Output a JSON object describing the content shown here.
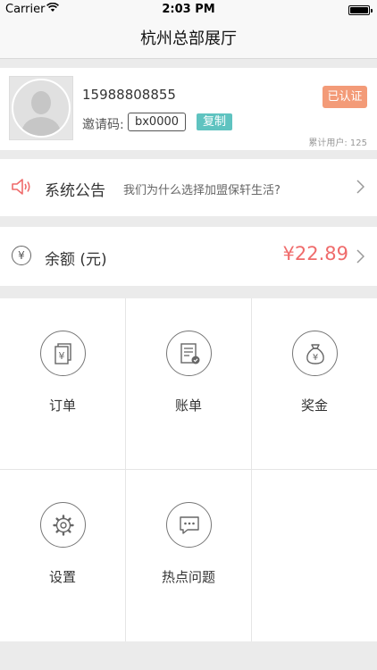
{
  "status_bar": {
    "carrier": "Carrier",
    "time": "2:03 PM"
  },
  "nav": {
    "title": "杭州总部展厅"
  },
  "profile": {
    "phone": "15988808855",
    "invite_label": "邀请码:",
    "invite_code": "bx0000",
    "copy_label": "复制",
    "verified_label": "已认证",
    "total_users": "累计用户: 125"
  },
  "notice": {
    "title": "系统公告",
    "text": "我们为什么选择加盟保轩生活?"
  },
  "balance": {
    "currency_symbol": "¥",
    "label": "余额 (元)",
    "amount": "¥22.89"
  },
  "menu": [
    {
      "label": "订单",
      "icon": "order-icon"
    },
    {
      "label": "账单",
      "icon": "bill-icon"
    },
    {
      "label": "奖金",
      "icon": "bonus-icon"
    },
    {
      "label": "设置",
      "icon": "settings-icon"
    },
    {
      "label": "热点问题",
      "icon": "faq-icon"
    }
  ],
  "colors": {
    "accent_red": "#ef6b6b",
    "copy_teal": "#5fc3c0",
    "verified_orange": "#f39b78"
  }
}
